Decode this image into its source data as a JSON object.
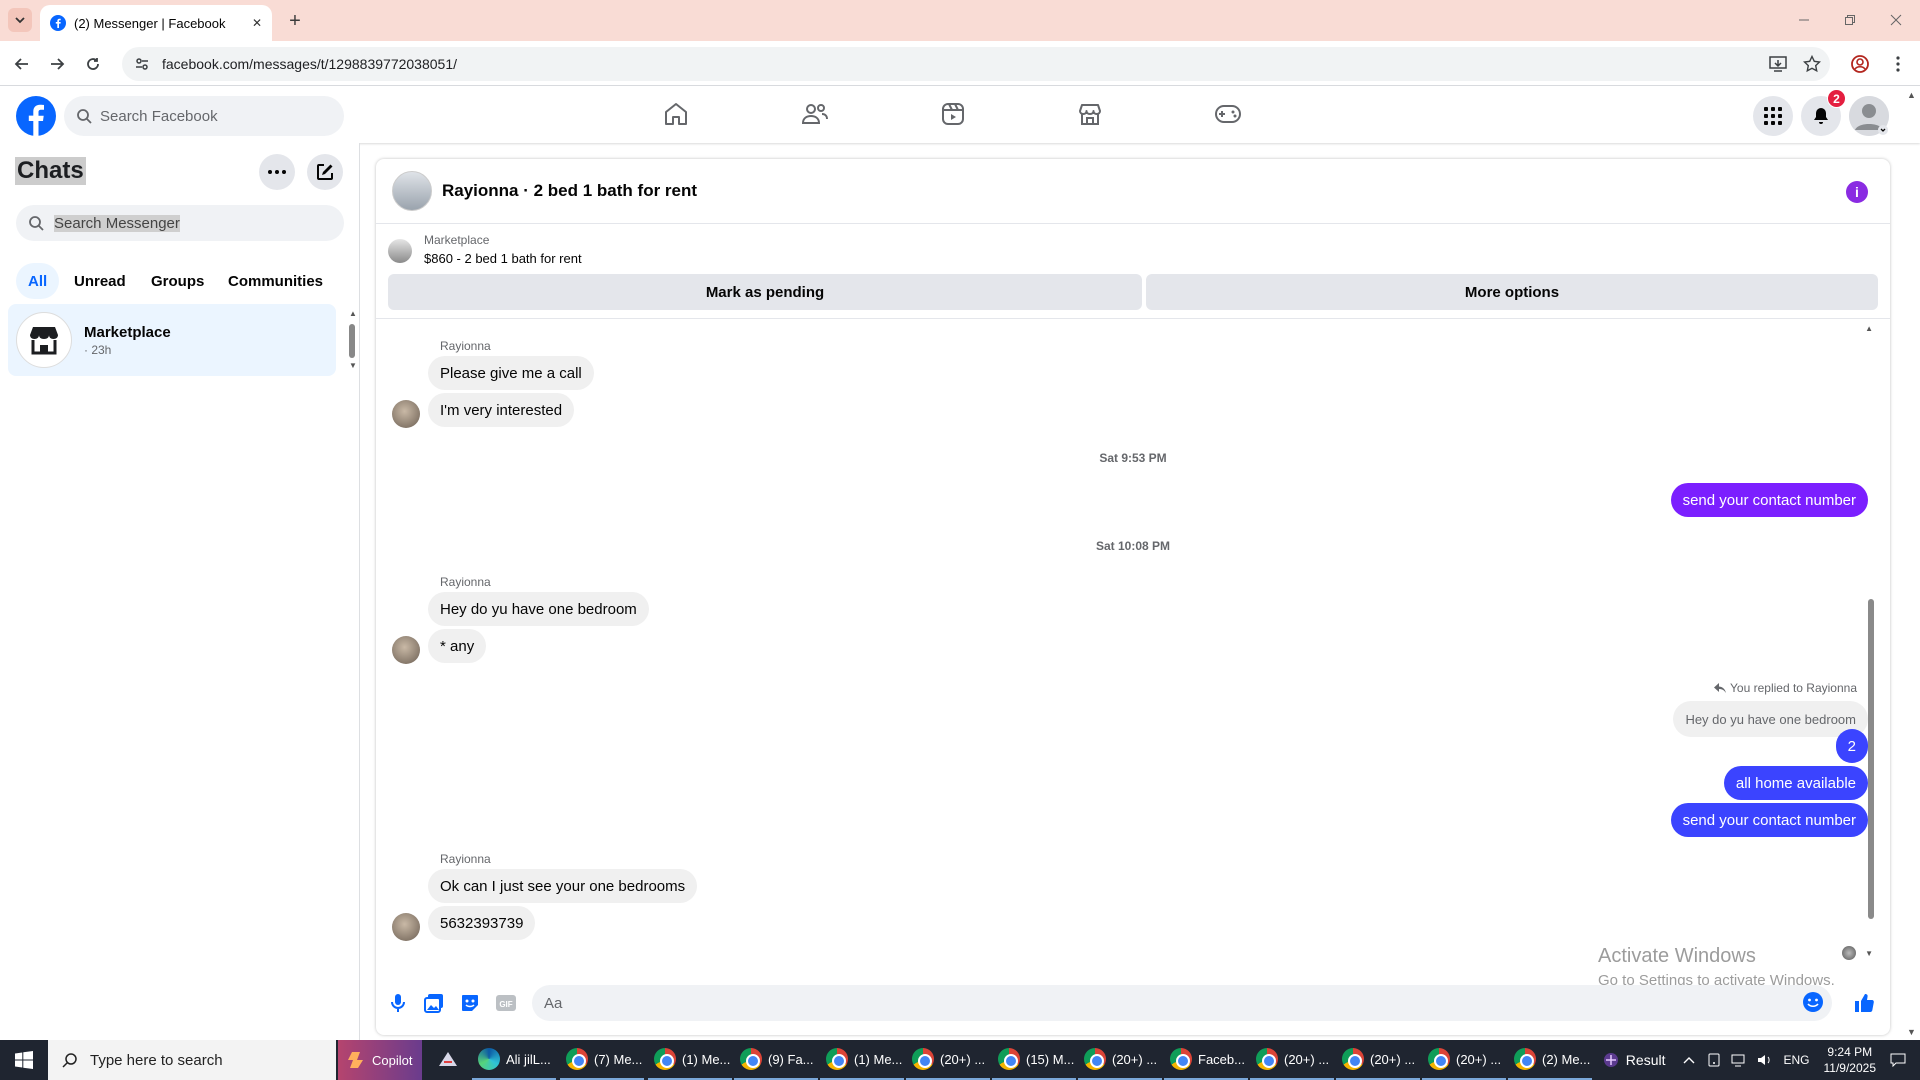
{
  "browser": {
    "tab_title": "(2) Messenger | Facebook",
    "url": "facebook.com/messages/t/1298839772038051/",
    "new_tab": "+",
    "tab_close": "✕"
  },
  "facebook": {
    "search_placeholder": "Search Facebook",
    "notification_count": "2"
  },
  "chats_panel": {
    "title": "Chats",
    "search_placeholder": "Search Messenger",
    "filters": [
      "All",
      "Unread",
      "Groups",
      "Communities"
    ],
    "items": [
      {
        "name": "Marketplace",
        "time": "· 23h"
      }
    ]
  },
  "conversation": {
    "title": "Rayionna · 2 bed 1 bath for rent",
    "marketplace_label": "Marketplace",
    "listing": "$860 - 2 bed 1 bath for rent",
    "buttons": {
      "pending": "Mark as pending",
      "more": "More options"
    },
    "sender_name": "Rayionna",
    "messages": {
      "m1": "Please give me a call",
      "m2": "I'm very interested",
      "ts1": "Sat 9:53 PM",
      "o1": "send your contact number",
      "ts2": "Sat 10:08 PM",
      "m3": "Hey do yu have one bedroom",
      "m4": "* any",
      "replied_note": "You replied to Rayionna",
      "replied_quote": "Hey do yu have one bedroom",
      "o2": "2",
      "o3": "all home available",
      "o4": "send your contact number",
      "m5": "Ok can I just see your one bedrooms",
      "m6": "5632393739"
    },
    "composer_placeholder": "Aa",
    "watermark": {
      "title": "Activate Windows",
      "subtitle": "Go to Settings to activate Windows."
    }
  },
  "taskbar": {
    "search_placeholder": "Type here to search",
    "copilot": "Copilot",
    "apps": [
      "Ali jilL...",
      "(7) Me...",
      "(1) Me...",
      "(9) Fa...",
      "(1) Me...",
      "(20+) ...",
      "(15) M...",
      "(20+) ...",
      "Faceb...",
      "(20+) ...",
      "(20+) ...",
      "(20+) ...",
      "(2) Me..."
    ],
    "result": "Result",
    "lang": "ENG",
    "time": "9:24 PM",
    "date": "11/9/2025"
  },
  "colors": {
    "fb_blue": "#0866ff",
    "outgoing_purple": "#7b1fff",
    "outgoing_blue": "#3b44ff"
  }
}
